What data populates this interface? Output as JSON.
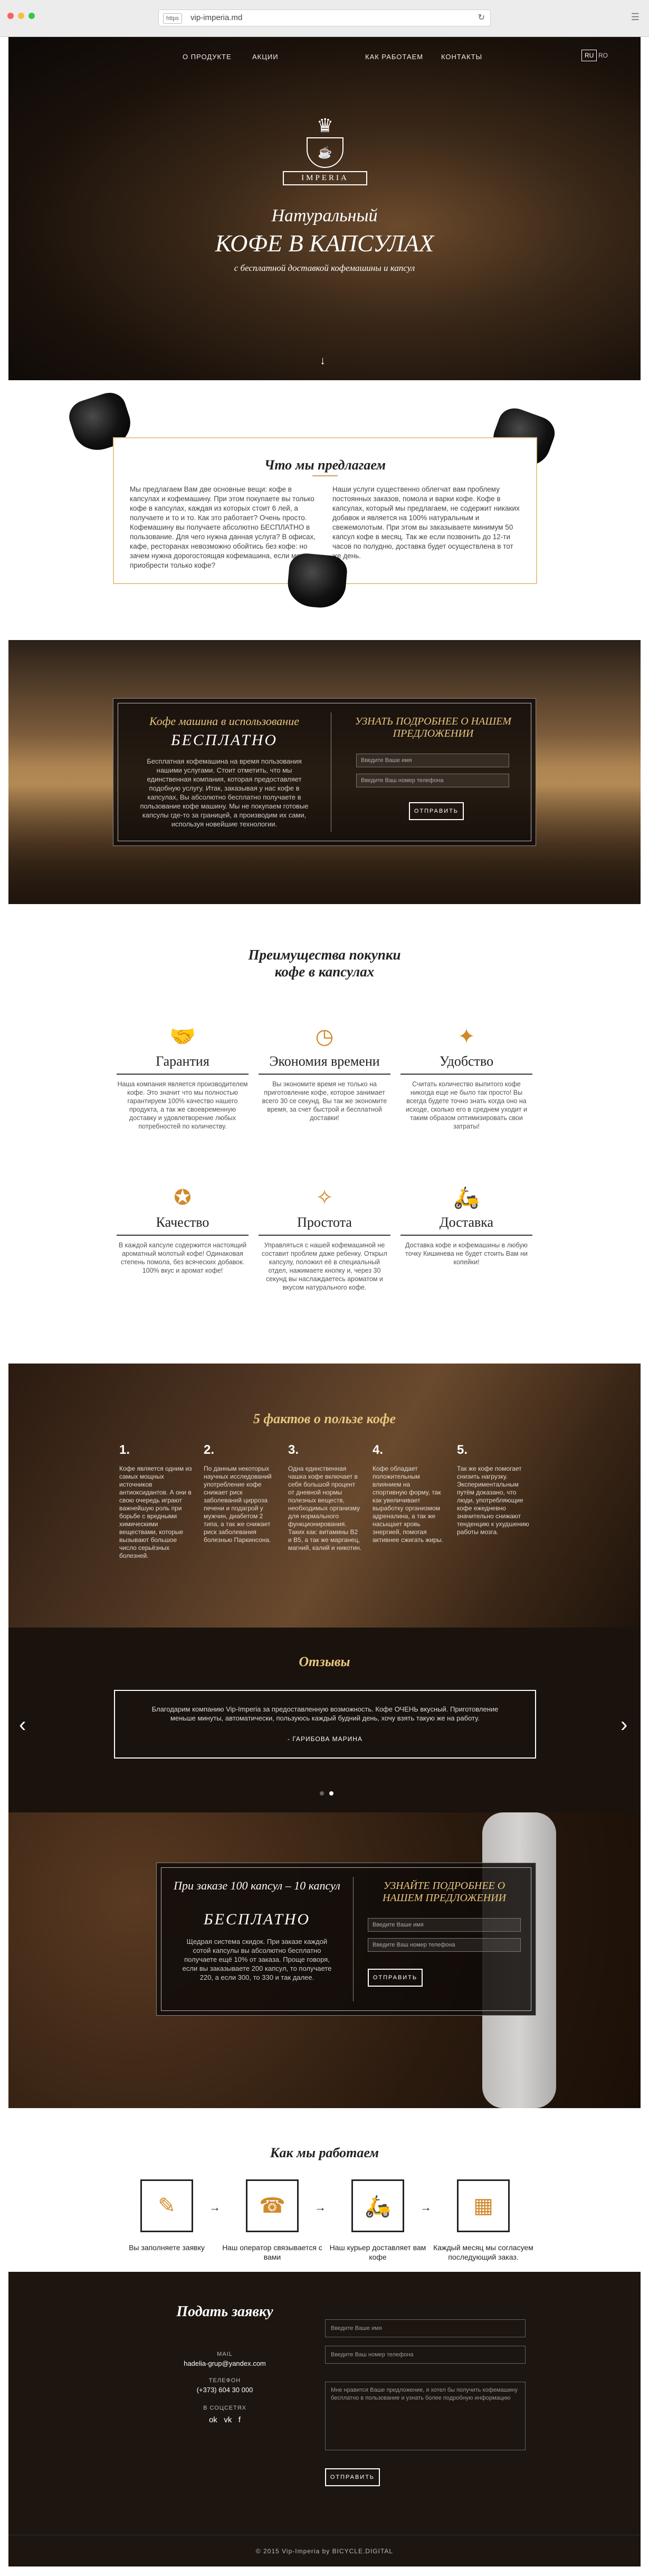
{
  "browser": {
    "url_tag": "https",
    "url": "vip-imperia.md"
  },
  "nav": {
    "items": [
      "О ПРОДУКТЕ",
      "АКЦИИ",
      "КАК РАБОТАЕМ",
      "КОНТАКТЫ"
    ],
    "lang_active": "RU",
    "lang_other": "RO"
  },
  "hero": {
    "logo_text": "IMPERIA",
    "title_line1": "Натуральный",
    "title_line2": "КОФЕ В КАПСУЛАХ",
    "subtitle": "с бесплатной доставкой кофемашины и капсул"
  },
  "offer": {
    "title": "Что мы предлагаем",
    "left_text": "Мы предлагаем Вам две основные вещи: кофе в капсулах и кофемашину. При этом покупаете вы только кофе в капсулах, каждая из которых стоит 6 лей, а получаете и то и то. Как это работает? Очень просто. Кофемашину вы получаете абсолютно БЕСПЛАТНО в пользование. Для чего нужна данная услуга? В офисах, кафе, ресторанах невозможно обойтись без кофе: но зачем нужна дорогостоящая кофемашина, если можно приобрести только кофе?",
    "right_text": "Наши услуги существенно облегчат вам проблему постоянных заказов, помола и варки кофе. Кофе в капсулах, который мы предлагаем, не содержит никаких добавок и является на 100% натуральным и свежемолотым. При этом вы заказываете минимум 50 капсул кофе в месяц. Так же если позвонить до 12-ти часов по полудню, доставка будет осуществлена в тот же день."
  },
  "machine": {
    "title": "Кофе машина в использование",
    "free": "БЕСПЛАТНО",
    "text": "Бесплатная кофемашина на время пользования нашими услугами. Стоит отметить, что мы единственная компания, которая предоставляет подобную услугу. Итак, заказывая у нас кофе в капсулах, Вы абсолютно бесплатно получаете в пользование кофе машину. Мы не покупаем готовые капсулы где-то за границей, а производим их сами, используя новейшие технологии.",
    "form_title": "УЗНАТЬ ПОДРОБНЕЕ О НАШЕМ ПРЕДЛОЖЕНИИ",
    "name_placeholder": "Введите Ваше имя",
    "phone_placeholder": "Введите Ваш номер телефона",
    "button": "ОТПРАВИТЬ"
  },
  "benefits": {
    "title_line1": "Преимущества покупки",
    "title_line2": "кофе в капсулах",
    "items": [
      {
        "icon": "handshake-icon",
        "glyph": "🤝",
        "name": "Гарантия",
        "desc": "Наша компания является производителем кофе. Это значит что мы полностью гарантируем 100% качество нашего продукта, а так же своевременную доставку и удовлетворение любых потребностей по количеству."
      },
      {
        "icon": "clock-icon",
        "glyph": "◷",
        "name": "Экономия времени",
        "desc": "Вы экономите время не только на приготовление кофе, которое занимает всего 30 се секунд. Вы так же экономите время, за счет быстрой и бесплатной доставки!"
      },
      {
        "icon": "wallet-icon",
        "glyph": "✦",
        "name": "Удобство",
        "desc": "Считать количество выпитого кофе никогда еще не было так просто! Вы всегда будете точно знать когда оно на исходе, сколько его в среднем уходит и таким образом оптимизировать свои затраты!"
      },
      {
        "icon": "award-icon",
        "glyph": "✪",
        "name": "Качество",
        "desc": "В каждой капсуле содержится настоящий ароматный молотый кофе! Одинаковая степень помола, без всяческих добавок. 100% вкус и аромат кофе!"
      },
      {
        "icon": "magic-wand-icon",
        "glyph": "✧",
        "name": "Простота",
        "desc": "Управляться с нашей кофемашиной не составит проблем даже ребенку. Открыл капсулу, положил её в специальный отдел, нажимаете кнопку и, через 30 секунд вы наслаждаетесь ароматом и вкусом натурального кофе."
      },
      {
        "icon": "scooter-icon",
        "glyph": "🛵",
        "name": "Доставка",
        "desc": "Доставка кофе и кофемашины в любую точку Кишинева не будет стоить Вам ни копейки!"
      }
    ]
  },
  "facts": {
    "title": "5 фактов о пользе кофе",
    "items": [
      {
        "n": "1.",
        "d": "Кофе является одним из самых мощных источников антиоксидантов. А они в свою очередь играют важнейшую роль при борьбе с вредными химическими веществами, которые вызывают большое число серьёзных болезней."
      },
      {
        "n": "2.",
        "d": "По данным некоторых научных исследований употребление кофе снижает риск заболеваний цирроза печени и подагрой у мужчин, диабетом 2 типа, а так же снижает риск заболевания болезнью Паркинсона."
      },
      {
        "n": "3.",
        "d": "Одна единственная чашка кофе включает в себя большой процент от дневной нормы полезных веществ, необходимых организму для нормального функционирования. Таких как: витамины В2 и В5, а так же марганец, магний, калий и никотин."
      },
      {
        "n": "4.",
        "d": "Кофе обладает положительным влиянием на спортивную форму, так как увеличивает выработку организмом адреналина, а так же насыщает кровь энергией, помогая активнее сжигать жиры."
      },
      {
        "n": "5.",
        "d": "Так же кофе помогает снизить нагрузку. Экспериментальным путём доказано, что люди, употребляющие кофе ежедневно значительно снижают тенденцию к ухудшению работы мозга."
      }
    ]
  },
  "reviews": {
    "title": "Отзывы",
    "text": "Благодарим компанию Vip-Imperia за предоставленную возможность. Кофе ОЧЕНЬ вкусный. Приготовление меньше минуты, автоматически, пользуюсь каждый будний день, хочу взять такую же на работу.",
    "author": "- ГАРИБОВА МАРИНА"
  },
  "promo": {
    "title": "При заказе 100 капсул – 10 капсул",
    "free": "БЕСПЛАТНО",
    "text": "Щедрая система скидок. При заказе каждой сотой капсулы вы абсолютно бесплатно получаете ещё 10% от заказа. Проще говоря, если вы заказываете 200 капсул, то получаете 220, а если 300, то 330 и так далее.",
    "form_title": "УЗНАЙТЕ ПОДРОБНЕЕ О НАШЕМ ПРЕДЛОЖЕНИИ",
    "name_placeholder": "Введите Ваше имя",
    "phone_placeholder": "Введите Ваш номер телефона",
    "button": "ОТПРАВИТЬ"
  },
  "how": {
    "title": "Как мы работаем",
    "steps": [
      {
        "icon": "form-icon",
        "glyph": "✎",
        "label": "Вы заполняете заявку"
      },
      {
        "icon": "phone-icon",
        "glyph": "☎",
        "label": "Наш оператор связывается с вами"
      },
      {
        "icon": "scooter-icon",
        "glyph": "🛵",
        "label": "Наш курьер доставляет вам кофе"
      },
      {
        "icon": "calendar-icon",
        "glyph": "▦",
        "label": "Каждый месяц мы согласуем последующий заказ."
      }
    ]
  },
  "footer": {
    "title": "Подать заявку",
    "mail_label": "MAIL",
    "mail": "hadelia-grup@yandex.com",
    "phone_label": "ТЕЛЕФОН",
    "phone": "(+373) 604 30 000",
    "social_label": "В СОЦСЕТЯХ",
    "name_placeholder": "Введите Ваше имя",
    "phone_placeholder": "Введите Ваш номер телефона",
    "message_placeholder": "Мне нравится Ваше предложение, я хотел бы получить кофемашину бесплатно в пользование и узнать более подробную информацию",
    "button": "ОТПРАВИТЬ",
    "copyright": "© 2015 Vip-Imperia by BICYCLE.DIGITAL"
  }
}
